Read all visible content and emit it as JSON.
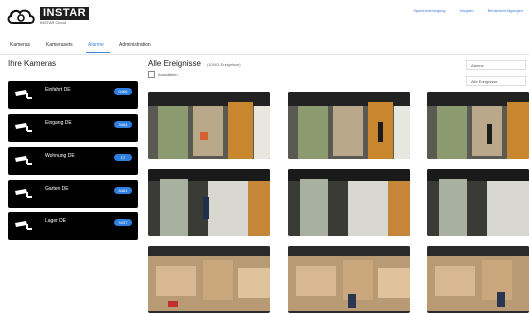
{
  "header": {
    "brand": "INSTAR",
    "brand_sub": "INSTAR Cloud",
    "top_links": [
      "Speicherbelegung",
      "Hauptm",
      "Benachrichtigungen"
    ]
  },
  "nav": {
    "tabs": [
      "Kameras",
      "Kamerasets",
      "Alarme",
      "Administration"
    ],
    "active": "Alarme"
  },
  "left": {
    "title": "Ihre Kameras",
    "cameras": [
      {
        "name": "Einfahrt DE",
        "badge": "0466"
      },
      {
        "name": "Eingang DE",
        "badge": "3464"
      },
      {
        "name": "Wohnung DE",
        "badge": "17"
      },
      {
        "name": "Garten DE",
        "badge": "8461"
      },
      {
        "name": "Lager DE",
        "badge": "9437"
      }
    ]
  },
  "main": {
    "title": "Alle Ereignisse",
    "count": "(10003 Ereignisse)",
    "select_all": "Auswählen"
  },
  "filters": {
    "first": "Alarme",
    "second": "Alle Ereignisse"
  },
  "colors": {
    "accent": "#3a8ad6",
    "badge": "#2f7fe0",
    "camera_bg": "#000000"
  },
  "icons": {
    "logo": "cloud-logo-icon",
    "camera": "security-camera-icon"
  }
}
